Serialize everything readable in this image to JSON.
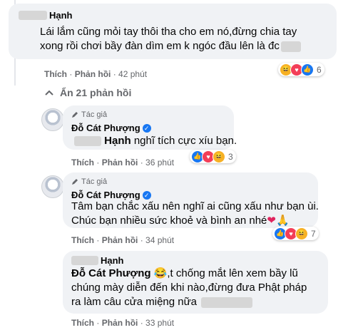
{
  "comment1": {
    "name": "Hạnh",
    "text_line1": "Lái lắm cũng mỏi tay thôi tha cho em nó,đừng chia tay",
    "text_line2": "xong rồi chơi bầy đàn dìm em k ngóc đầu lên là đc",
    "like": "Thích",
    "reply": "Phản hồi",
    "time": "42 phút",
    "reaction_count": "6",
    "dot": "·"
  },
  "hide_replies": {
    "icon": "chevron-up-icon",
    "label": "Ẩn 21 phản hồi"
  },
  "reply1": {
    "author_tag": "Tác giả",
    "name": "Đỗ Cát Phượng",
    "mention": "Hạnh",
    "text": " nghĩ tích cực xíu bạn.",
    "like": "Thích",
    "reply": "Phản hồi",
    "time": "36 phút",
    "reaction_count": "3"
  },
  "reply2": {
    "author_tag": "Tác giả",
    "name": "Đỗ Cát Phượng",
    "text_line1": "Tâm bạn chắc xấu nên nghĩ ai cũng xấu như bạn ùi.",
    "text_line2": "Chúc bạn nhiều sức khoẻ và bình an nhé",
    "emoji": "❤🙏",
    "like": "Thích",
    "reply": "Phản hồi",
    "time": "34 phút",
    "reaction_count": "7"
  },
  "reply3": {
    "name": "Hạnh",
    "mention": "Đỗ Cát Phượng",
    "emoji": "😂",
    "text_line1": ",t chống mắt lên xem bầy lũ",
    "text_line2": "chúng mày diễn đến khi nào,đừng đưa Phật pháp",
    "text_line3": "ra làm câu cửa miệng nữa",
    "like": "Thích",
    "reply": "Phản hồi",
    "time": "33 phút"
  },
  "colors": {
    "bubble": "#f0f2f5",
    "secondary_text": "#65676b",
    "accent": "#1877f2"
  }
}
